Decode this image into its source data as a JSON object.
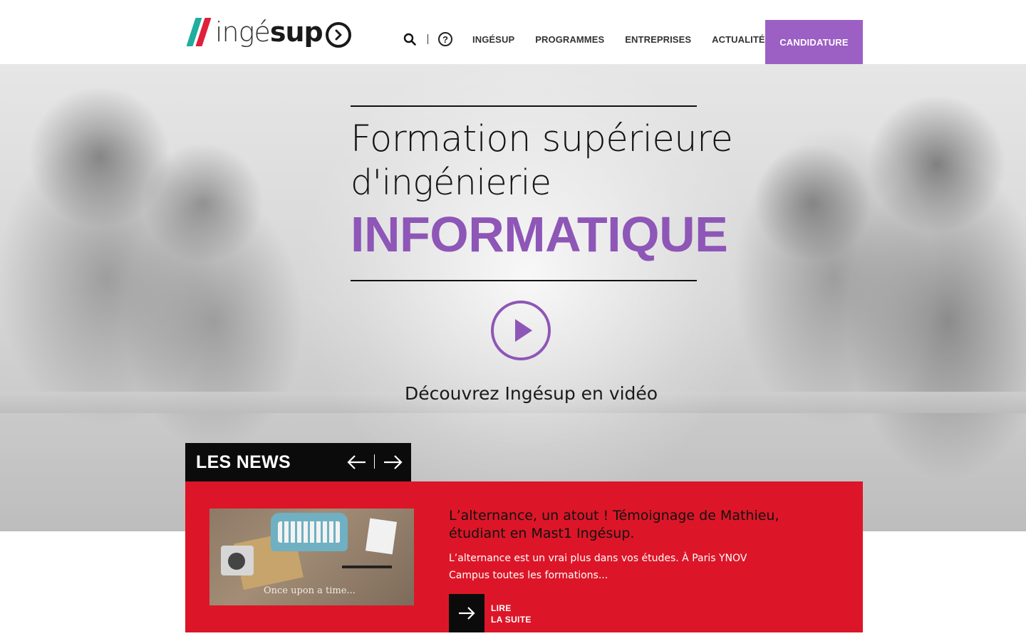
{
  "brand": {
    "logo_light": "ingé",
    "logo_bold": "sup",
    "colors": {
      "accent": "#9c5fc4",
      "headline_purple": "#8e56b7",
      "news_red": "#dc1628",
      "logo_teal": "#1fae9f",
      "logo_red": "#e0203a"
    }
  },
  "header": {
    "icons": [
      "search-icon",
      "help-icon"
    ],
    "help_glyph": "?",
    "nav": [
      "INGÉSUP",
      "PROGRAMMES",
      "ENTREPRISES",
      "ACTUALITÉS"
    ],
    "cta_label": "CANDIDATURE"
  },
  "hero": {
    "line1": "Formation supérieure",
    "line2": "d'ingénierie",
    "line3": "INFORMATIQUE",
    "video_label": "Découvrez Ingésup en vidéo"
  },
  "news": {
    "title": "LES NEWS",
    "image_caption": "Once upon a time...",
    "headline": "L’alternance, un atout ! Témoignage de Mathieu, étudiant en Mast1 Ingésup.",
    "excerpt": "L’alternance est un vrai plus dans vos études. À Paris YNOV Campus toutes les formations...",
    "read_more_line1": "LIRE",
    "read_more_line2": "LA SUITE"
  }
}
